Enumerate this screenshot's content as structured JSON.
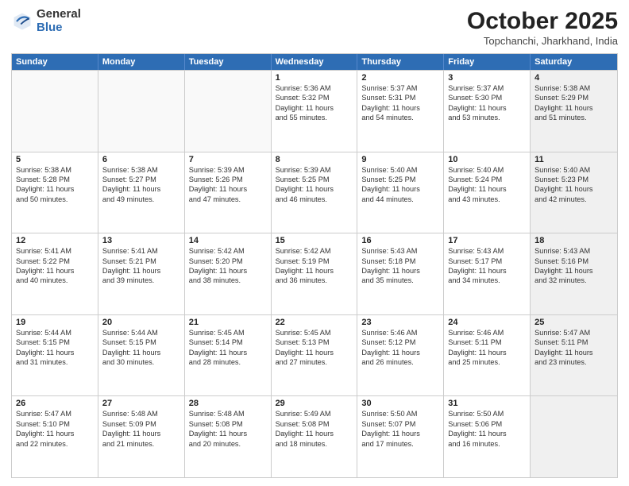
{
  "logo": {
    "general": "General",
    "blue": "Blue"
  },
  "header": {
    "month": "October 2025",
    "location": "Topchanchi, Jharkhand, India"
  },
  "weekdays": [
    "Sunday",
    "Monday",
    "Tuesday",
    "Wednesday",
    "Thursday",
    "Friday",
    "Saturday"
  ],
  "rows": [
    [
      {
        "day": "",
        "lines": [],
        "empty": true
      },
      {
        "day": "",
        "lines": [],
        "empty": true
      },
      {
        "day": "",
        "lines": [],
        "empty": true
      },
      {
        "day": "1",
        "lines": [
          "Sunrise: 5:36 AM",
          "Sunset: 5:32 PM",
          "Daylight: 11 hours",
          "and 55 minutes."
        ],
        "empty": false
      },
      {
        "day": "2",
        "lines": [
          "Sunrise: 5:37 AM",
          "Sunset: 5:31 PM",
          "Daylight: 11 hours",
          "and 54 minutes."
        ],
        "empty": false
      },
      {
        "day": "3",
        "lines": [
          "Sunrise: 5:37 AM",
          "Sunset: 5:30 PM",
          "Daylight: 11 hours",
          "and 53 minutes."
        ],
        "empty": false
      },
      {
        "day": "4",
        "lines": [
          "Sunrise: 5:38 AM",
          "Sunset: 5:29 PM",
          "Daylight: 11 hours",
          "and 51 minutes."
        ],
        "empty": false,
        "shaded": true
      }
    ],
    [
      {
        "day": "5",
        "lines": [
          "Sunrise: 5:38 AM",
          "Sunset: 5:28 PM",
          "Daylight: 11 hours",
          "and 50 minutes."
        ],
        "empty": false
      },
      {
        "day": "6",
        "lines": [
          "Sunrise: 5:38 AM",
          "Sunset: 5:27 PM",
          "Daylight: 11 hours",
          "and 49 minutes."
        ],
        "empty": false
      },
      {
        "day": "7",
        "lines": [
          "Sunrise: 5:39 AM",
          "Sunset: 5:26 PM",
          "Daylight: 11 hours",
          "and 47 minutes."
        ],
        "empty": false
      },
      {
        "day": "8",
        "lines": [
          "Sunrise: 5:39 AM",
          "Sunset: 5:25 PM",
          "Daylight: 11 hours",
          "and 46 minutes."
        ],
        "empty": false
      },
      {
        "day": "9",
        "lines": [
          "Sunrise: 5:40 AM",
          "Sunset: 5:25 PM",
          "Daylight: 11 hours",
          "and 44 minutes."
        ],
        "empty": false
      },
      {
        "day": "10",
        "lines": [
          "Sunrise: 5:40 AM",
          "Sunset: 5:24 PM",
          "Daylight: 11 hours",
          "and 43 minutes."
        ],
        "empty": false
      },
      {
        "day": "11",
        "lines": [
          "Sunrise: 5:40 AM",
          "Sunset: 5:23 PM",
          "Daylight: 11 hours",
          "and 42 minutes."
        ],
        "empty": false,
        "shaded": true
      }
    ],
    [
      {
        "day": "12",
        "lines": [
          "Sunrise: 5:41 AM",
          "Sunset: 5:22 PM",
          "Daylight: 11 hours",
          "and 40 minutes."
        ],
        "empty": false
      },
      {
        "day": "13",
        "lines": [
          "Sunrise: 5:41 AM",
          "Sunset: 5:21 PM",
          "Daylight: 11 hours",
          "and 39 minutes."
        ],
        "empty": false
      },
      {
        "day": "14",
        "lines": [
          "Sunrise: 5:42 AM",
          "Sunset: 5:20 PM",
          "Daylight: 11 hours",
          "and 38 minutes."
        ],
        "empty": false
      },
      {
        "day": "15",
        "lines": [
          "Sunrise: 5:42 AM",
          "Sunset: 5:19 PM",
          "Daylight: 11 hours",
          "and 36 minutes."
        ],
        "empty": false
      },
      {
        "day": "16",
        "lines": [
          "Sunrise: 5:43 AM",
          "Sunset: 5:18 PM",
          "Daylight: 11 hours",
          "and 35 minutes."
        ],
        "empty": false
      },
      {
        "day": "17",
        "lines": [
          "Sunrise: 5:43 AM",
          "Sunset: 5:17 PM",
          "Daylight: 11 hours",
          "and 34 minutes."
        ],
        "empty": false
      },
      {
        "day": "18",
        "lines": [
          "Sunrise: 5:43 AM",
          "Sunset: 5:16 PM",
          "Daylight: 11 hours",
          "and 32 minutes."
        ],
        "empty": false,
        "shaded": true
      }
    ],
    [
      {
        "day": "19",
        "lines": [
          "Sunrise: 5:44 AM",
          "Sunset: 5:15 PM",
          "Daylight: 11 hours",
          "and 31 minutes."
        ],
        "empty": false
      },
      {
        "day": "20",
        "lines": [
          "Sunrise: 5:44 AM",
          "Sunset: 5:15 PM",
          "Daylight: 11 hours",
          "and 30 minutes."
        ],
        "empty": false
      },
      {
        "day": "21",
        "lines": [
          "Sunrise: 5:45 AM",
          "Sunset: 5:14 PM",
          "Daylight: 11 hours",
          "and 28 minutes."
        ],
        "empty": false
      },
      {
        "day": "22",
        "lines": [
          "Sunrise: 5:45 AM",
          "Sunset: 5:13 PM",
          "Daylight: 11 hours",
          "and 27 minutes."
        ],
        "empty": false
      },
      {
        "day": "23",
        "lines": [
          "Sunrise: 5:46 AM",
          "Sunset: 5:12 PM",
          "Daylight: 11 hours",
          "and 26 minutes."
        ],
        "empty": false
      },
      {
        "day": "24",
        "lines": [
          "Sunrise: 5:46 AM",
          "Sunset: 5:11 PM",
          "Daylight: 11 hours",
          "and 25 minutes."
        ],
        "empty": false
      },
      {
        "day": "25",
        "lines": [
          "Sunrise: 5:47 AM",
          "Sunset: 5:11 PM",
          "Daylight: 11 hours",
          "and 23 minutes."
        ],
        "empty": false,
        "shaded": true
      }
    ],
    [
      {
        "day": "26",
        "lines": [
          "Sunrise: 5:47 AM",
          "Sunset: 5:10 PM",
          "Daylight: 11 hours",
          "and 22 minutes."
        ],
        "empty": false
      },
      {
        "day": "27",
        "lines": [
          "Sunrise: 5:48 AM",
          "Sunset: 5:09 PM",
          "Daylight: 11 hours",
          "and 21 minutes."
        ],
        "empty": false
      },
      {
        "day": "28",
        "lines": [
          "Sunrise: 5:48 AM",
          "Sunset: 5:08 PM",
          "Daylight: 11 hours",
          "and 20 minutes."
        ],
        "empty": false
      },
      {
        "day": "29",
        "lines": [
          "Sunrise: 5:49 AM",
          "Sunset: 5:08 PM",
          "Daylight: 11 hours",
          "and 18 minutes."
        ],
        "empty": false
      },
      {
        "day": "30",
        "lines": [
          "Sunrise: 5:50 AM",
          "Sunset: 5:07 PM",
          "Daylight: 11 hours",
          "and 17 minutes."
        ],
        "empty": false
      },
      {
        "day": "31",
        "lines": [
          "Sunrise: 5:50 AM",
          "Sunset: 5:06 PM",
          "Daylight: 11 hours",
          "and 16 minutes."
        ],
        "empty": false
      },
      {
        "day": "",
        "lines": [],
        "empty": true,
        "shaded": true
      }
    ]
  ]
}
